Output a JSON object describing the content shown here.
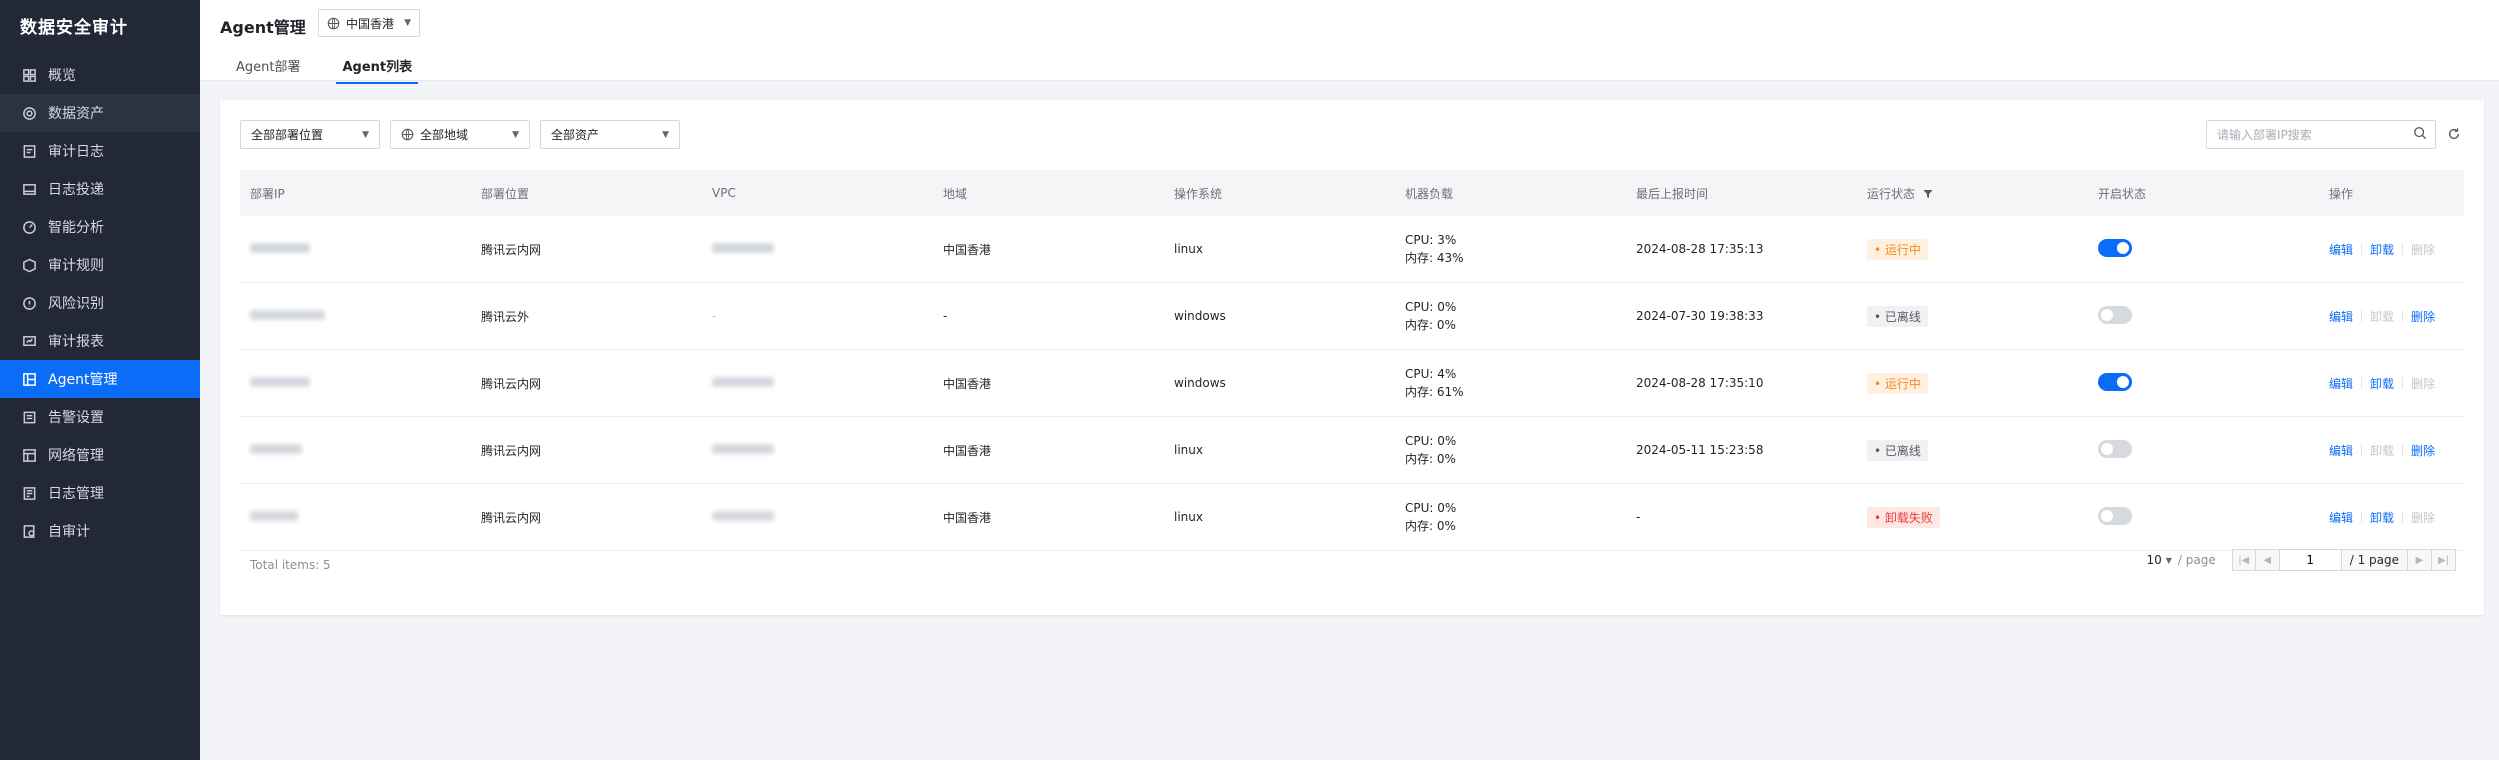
{
  "brand": "数据安全审计",
  "sidebar": {
    "items": [
      {
        "label": "概览",
        "icon": "dashboard-icon"
      },
      {
        "label": "数据资产",
        "icon": "asset-icon"
      },
      {
        "label": "审计日志",
        "icon": "audit-log-icon"
      },
      {
        "label": "日志投递",
        "icon": "log-delivery-icon"
      },
      {
        "label": "智能分析",
        "icon": "analysis-icon"
      },
      {
        "label": "审计规则",
        "icon": "rules-icon"
      },
      {
        "label": "风险识别",
        "icon": "risk-icon"
      },
      {
        "label": "审计报表",
        "icon": "report-icon"
      },
      {
        "label": "Agent管理",
        "icon": "agent-icon"
      },
      {
        "label": "告警设置",
        "icon": "alert-icon"
      },
      {
        "label": "网络管理",
        "icon": "network-icon"
      },
      {
        "label": "日志管理",
        "icon": "log-manage-icon"
      },
      {
        "label": "自审计",
        "icon": "self-audit-icon"
      }
    ]
  },
  "header": {
    "title": "Agent管理",
    "region": "中国香港",
    "tabs": [
      "Agent部署",
      "Agent列表"
    ]
  },
  "filters": {
    "position": "全部部署位置",
    "region": "全部地域",
    "asset": "全部资产",
    "search_placeholder": "请输入部署IP搜索"
  },
  "table": {
    "columns": [
      "部署IP",
      "部署位置",
      "VPC",
      "地域",
      "操作系统",
      "机器负载",
      "最后上报时间",
      "运行状态",
      "开启状态",
      "操作"
    ],
    "rows": [
      {
        "location": "腾讯云内网",
        "vpc_text": "",
        "region": "中国香港",
        "os": "linux",
        "cpu": "CPU: 3%",
        "mem": "内存: 43%",
        "last_report": "2024-08-28 17:35:13",
        "status": "• 运行中",
        "status_type": "running",
        "enabled": true,
        "ops": [
          {
            "label": "编辑",
            "enabled": true
          },
          {
            "label": "卸载",
            "enabled": true
          },
          {
            "label": "删除",
            "enabled": false
          }
        ]
      },
      {
        "location": "腾讯云外",
        "vpc_text": "-",
        "region": "-",
        "os": "windows",
        "cpu": "CPU: 0%",
        "mem": "内存: 0%",
        "last_report": "2024-07-30 19:38:33",
        "status": "• 已离线",
        "status_type": "offline",
        "enabled": false,
        "ops": [
          {
            "label": "编辑",
            "enabled": true
          },
          {
            "label": "卸载",
            "enabled": false
          },
          {
            "label": "删除",
            "enabled": true
          }
        ]
      },
      {
        "location": "腾讯云内网",
        "vpc_text": "",
        "region": "中国香港",
        "os": "windows",
        "cpu": "CPU: 4%",
        "mem": "内存: 61%",
        "last_report": "2024-08-28 17:35:10",
        "status": "• 运行中",
        "status_type": "running",
        "enabled": true,
        "ops": [
          {
            "label": "编辑",
            "enabled": true
          },
          {
            "label": "卸载",
            "enabled": true
          },
          {
            "label": "删除",
            "enabled": false
          }
        ]
      },
      {
        "location": "腾讯云内网",
        "vpc_text": "",
        "region": "中国香港",
        "os": "linux",
        "cpu": "CPU: 0%",
        "mem": "内存: 0%",
        "last_report": "2024-05-11 15:23:58",
        "status": "• 已离线",
        "status_type": "offline",
        "enabled": false,
        "ops": [
          {
            "label": "编辑",
            "enabled": true
          },
          {
            "label": "卸载",
            "enabled": false
          },
          {
            "label": "删除",
            "enabled": true
          }
        ]
      },
      {
        "location": "腾讯云内网",
        "vpc_text": "",
        "region": "中国香港",
        "os": "linux",
        "cpu": "CPU: 0%",
        "mem": "内存: 0%",
        "last_report": "-",
        "status": "• 卸载失败",
        "status_type": "failed",
        "enabled": false,
        "ops": [
          {
            "label": "编辑",
            "enabled": true
          },
          {
            "label": "卸载",
            "enabled": true
          },
          {
            "label": "删除",
            "enabled": false
          }
        ]
      }
    ]
  },
  "footer": {
    "total": "Total items: 5",
    "page_size": "10",
    "per_page": "/ page",
    "current_page": "1",
    "total_pages": "/ 1 page"
  },
  "colors": {
    "sidebar_bg": "#222836",
    "accent": "#0b6cf7",
    "running": "#f58a1f",
    "failed": "#e5403c"
  }
}
